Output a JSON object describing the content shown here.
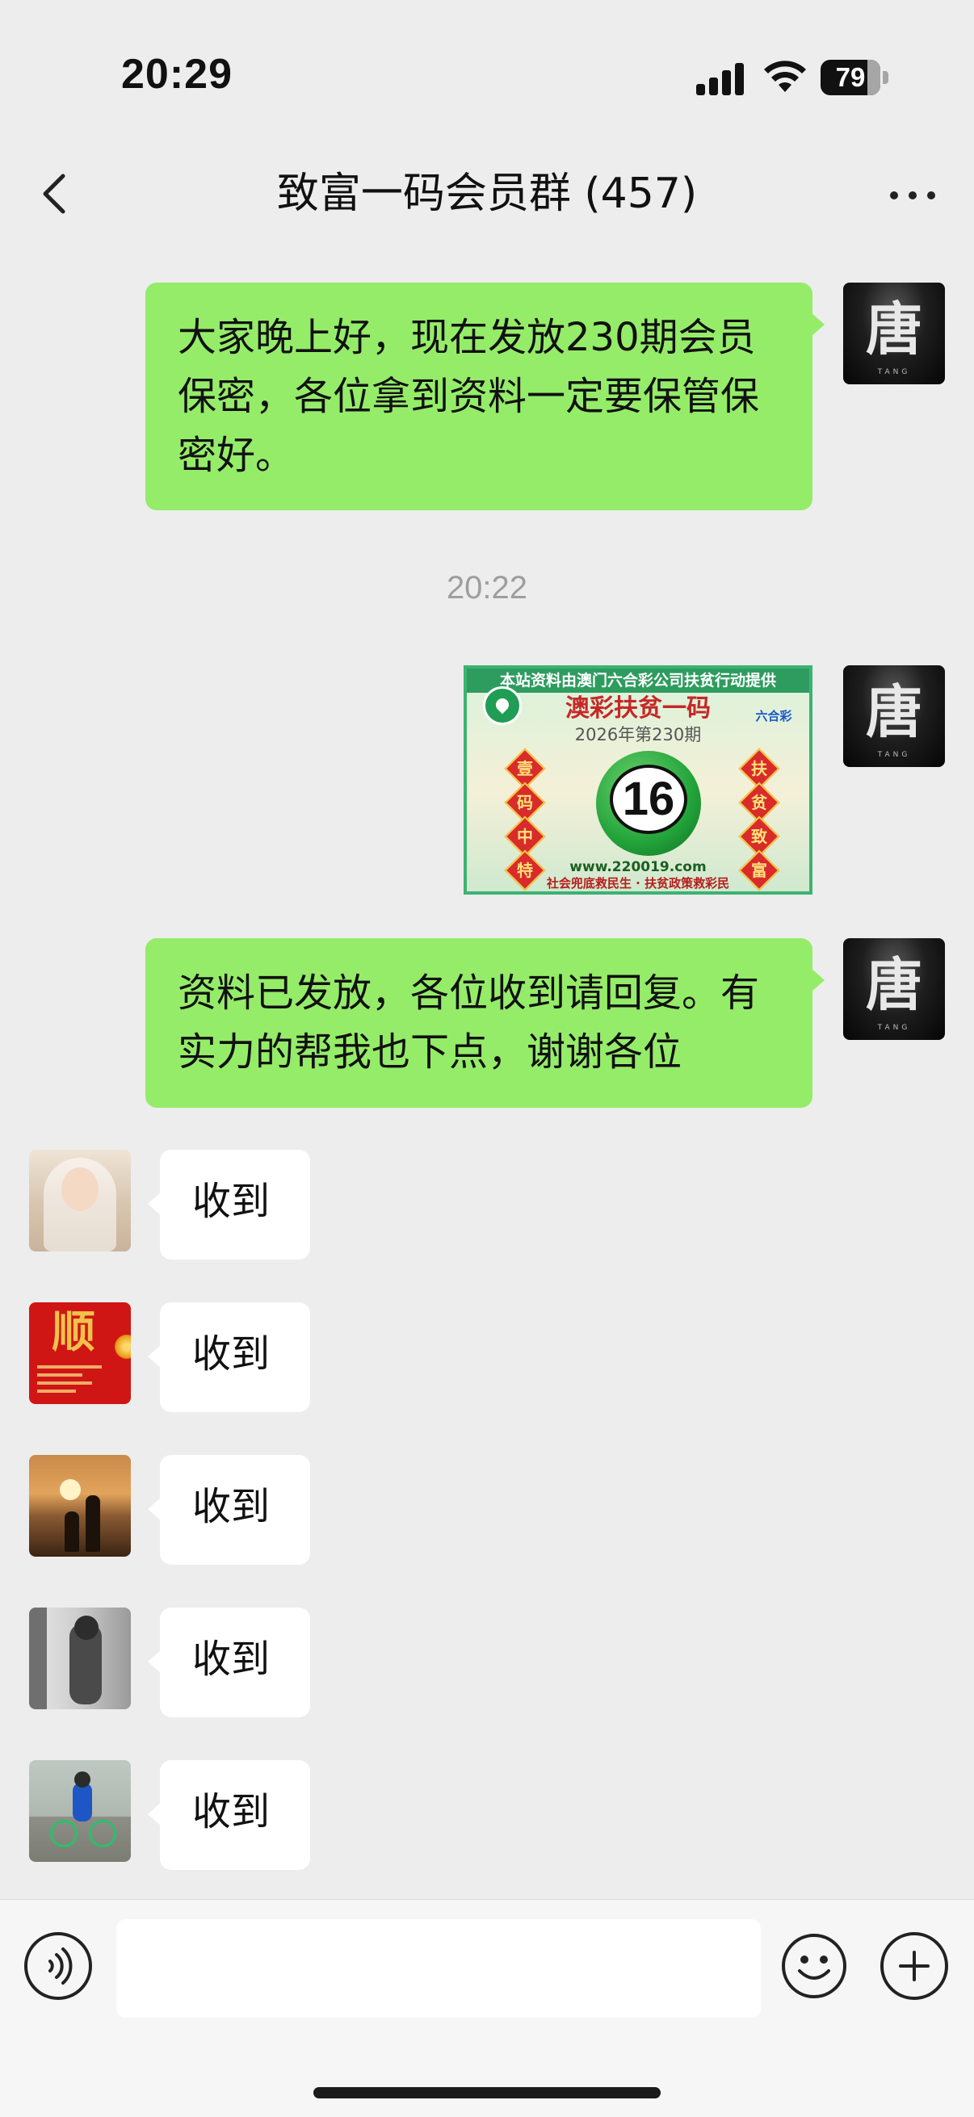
{
  "status_bar": {
    "time": "20:29",
    "battery": "79",
    "battery_level_percent": 79,
    "icons": [
      "cellular-signal-icon",
      "wifi-icon",
      "battery-icon"
    ]
  },
  "nav": {
    "title": "致富一码会员群 (457)",
    "back_icon": "chevron-left-icon",
    "more_icon": "more-dots-icon"
  },
  "messages": {
    "m1": {
      "text": "大家晚上好，现在发放230期会员保密，各位拿到资料一定要保管保密好。"
    },
    "timestamp": "20:22",
    "image": {
      "top_banner": "本站资料由澳门六合彩公司扶贫行动提供",
      "title": "澳彩扶贫一码",
      "issue": "2026年第230期",
      "logo_text": "六合彩",
      "left_chars": [
        "壹",
        "码",
        "中",
        "特"
      ],
      "right_chars": [
        "扶",
        "贫",
        "致",
        "富"
      ],
      "number": "16",
      "url": "www.220019.com",
      "footer": "社会兜底救民生 · 扶贫政策救彩民"
    },
    "m3": {
      "text": "资料已发放，各位收到请回复。有实力的帮我也下点，谢谢各位"
    },
    "replies": [
      "收到",
      "收到",
      "收到",
      "收到",
      "收到"
    ],
    "avatar_self_glyph": "唐",
    "avatar_self_sub": "TANG",
    "avatar_2_glyph": "顺"
  },
  "input_bar": {
    "placeholder": "",
    "voice_icon": "voice-icon",
    "emoji_icon": "emoji-icon",
    "plus_icon": "plus-icon"
  },
  "colors": {
    "background": "#ededed",
    "outgoing_bubble": "#95ec69",
    "incoming_bubble": "#ffffff",
    "timestamp": "#9e9e9e"
  }
}
